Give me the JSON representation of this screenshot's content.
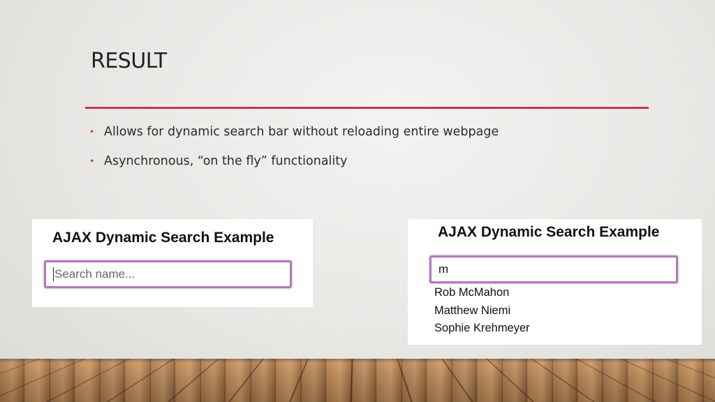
{
  "slide": {
    "title": "RESULT",
    "bullets": [
      "Allows for dynamic search bar without reloading entire webpage",
      "Asynchronous, “on the fly” functionality"
    ]
  },
  "left_demo": {
    "heading": "AJAX Dynamic Search Example",
    "search_placeholder": "Search name...",
    "search_value": ""
  },
  "right_demo": {
    "heading": "AJAX Dynamic Search Example",
    "search_value": "m",
    "results": [
      "Rob McMahon",
      "Matthew Niemi",
      "Sophie Krehmeyer"
    ]
  },
  "colors": {
    "accent": "#c8325a",
    "focus_border": "#b07ab8"
  }
}
